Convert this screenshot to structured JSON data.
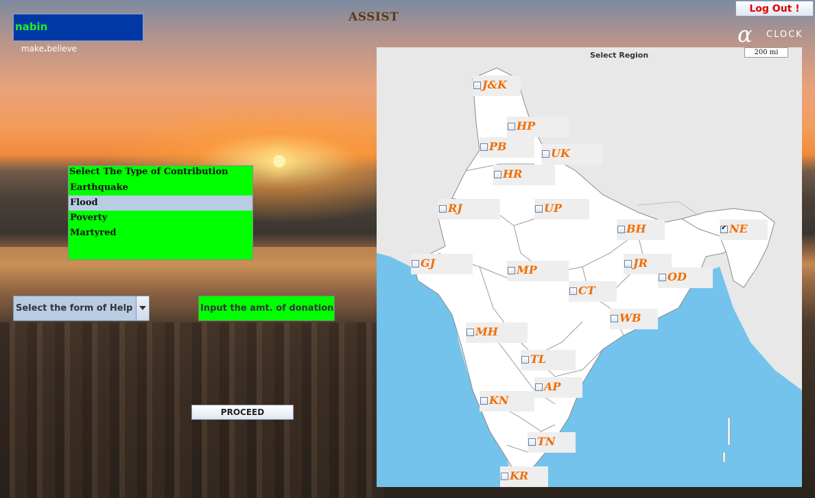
{
  "user": {
    "name": "nabin",
    "tagline_pre": "make",
    "tagline_dot": ".",
    "tagline_post": "believe"
  },
  "app": {
    "title": "ASSIST"
  },
  "header": {
    "logout_label": "Log Out !",
    "clock_symbol": "α",
    "clock_label": "CLOCK"
  },
  "contribution": {
    "header": "Select The Type of Contribution",
    "options": [
      "Earthquake",
      "Flood",
      "Poverty",
      "Martyred"
    ],
    "selected": "Flood"
  },
  "help_select": {
    "label": "Select the form of Help"
  },
  "amount": {
    "label": "Input the amt. of donation"
  },
  "proceed": {
    "label": "PROCEED"
  },
  "map": {
    "title": "Select Region",
    "scale": "200 mi",
    "regions": [
      {
        "label": "J&K",
        "checked": false
      },
      {
        "label": "HP",
        "checked": false
      },
      {
        "label": "PB",
        "checked": false
      },
      {
        "label": "UK",
        "checked": false
      },
      {
        "label": "HR",
        "checked": false
      },
      {
        "label": "RJ",
        "checked": false
      },
      {
        "label": "UP",
        "checked": false
      },
      {
        "label": "BH",
        "checked": false
      },
      {
        "label": "NE",
        "checked": true
      },
      {
        "label": "GJ",
        "checked": false
      },
      {
        "label": "JR",
        "checked": false
      },
      {
        "label": "MP",
        "checked": false
      },
      {
        "label": "OD",
        "checked": false
      },
      {
        "label": "CT",
        "checked": false
      },
      {
        "label": "WB",
        "checked": false
      },
      {
        "label": "MH",
        "checked": false
      },
      {
        "label": "TL",
        "checked": false
      },
      {
        "label": "AP",
        "checked": false
      },
      {
        "label": "KN",
        "checked": false
      },
      {
        "label": "TN",
        "checked": false
      },
      {
        "label": "KR",
        "checked": false
      }
    ]
  },
  "colors": {
    "accent_green": "#00ff00",
    "user_box": "#0039a6",
    "region_label": "#f26d00",
    "sea": "#74c3ec"
  }
}
